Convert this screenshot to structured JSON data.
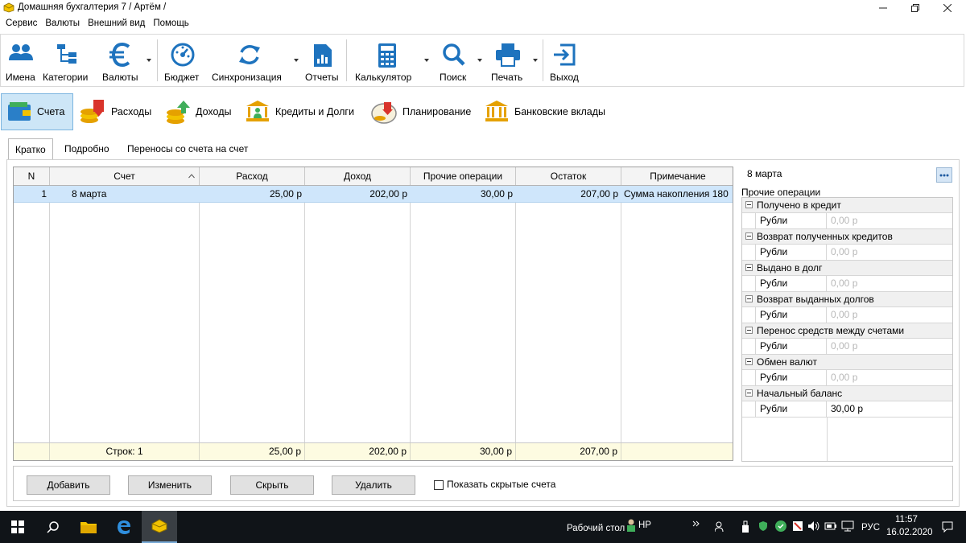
{
  "window": {
    "title": "Домашняя бухгалтерия 7  / Артём /"
  },
  "menu": [
    "Сервис",
    "Валюты",
    "Внешний вид",
    "Помощь"
  ],
  "toolbar": {
    "names": "Имена",
    "categories": "Категории",
    "currencies": "Валюты",
    "budget": "Бюджет",
    "sync": "Синхронизация",
    "reports": "Отчеты",
    "calculator": "Калькулятор",
    "search": "Поиск",
    "print": "Печать",
    "exit": "Выход"
  },
  "sections": {
    "accounts": "Счета",
    "expenses": "Расходы",
    "income": "Доходы",
    "credits": "Кредиты и Долги",
    "planning": "Планирование",
    "deposits": "Банковские вклады"
  },
  "view_tabs": {
    "short": "Кратко",
    "detailed": "Подробно",
    "transfers": "Переносы со счета на счет"
  },
  "grid": {
    "headers": {
      "n": "N",
      "account": "Счет",
      "expense": "Расход",
      "income": "Доход",
      "other": "Прочие операции",
      "balance": "Остаток",
      "note": "Примечание"
    },
    "rows": [
      {
        "n": "1",
        "account": "8 марта",
        "expense": "25,00 р",
        "income": "202,00 р",
        "other": "30,00 р",
        "balance": "207,00 р",
        "note": "Сумма накопления 180"
      }
    ],
    "footer": {
      "rows_count": "Строк: 1",
      "expense": "25,00 р",
      "income": "202,00 р",
      "other": "30,00 р",
      "balance": "207,00 р"
    }
  },
  "properties": {
    "account_name": "8 марта",
    "section_title": "Прочие операции",
    "groups": [
      {
        "name": "Получено в кредит",
        "key": "Рубли",
        "value": "0,00 р",
        "set": false
      },
      {
        "name": "Возврат полученных кредитов",
        "key": "Рубли",
        "value": "0,00 р",
        "set": false
      },
      {
        "name": "Выдано в долг",
        "key": "Рубли",
        "value": "0,00 р",
        "set": false
      },
      {
        "name": "Возврат выданных долгов",
        "key": "Рубли",
        "value": "0,00 р",
        "set": false
      },
      {
        "name": "Перенос средств между счетами",
        "key": "Рубли",
        "value": "0,00 р",
        "set": false
      },
      {
        "name": "Обмен валют",
        "key": "Рубли",
        "value": "0,00 р",
        "set": false
      },
      {
        "name": "Начальный баланс",
        "key": "Рубли",
        "value": "30,00 р",
        "set": true
      }
    ]
  },
  "buttons": {
    "add": "Добавить",
    "edit": "Изменить",
    "hide": "Скрыть",
    "delete": "Удалить",
    "show_hidden": "Показать скрытые счета"
  },
  "taskbar": {
    "desktop": "Рабочий стол",
    "user": "HP",
    "lang": "РУС",
    "time": "11:57",
    "date": "16.02.2020"
  },
  "colors": {
    "accent_blue": "#1e73be",
    "selected_row": "#cfe6fb",
    "footer_row": "#fdfbe1"
  }
}
